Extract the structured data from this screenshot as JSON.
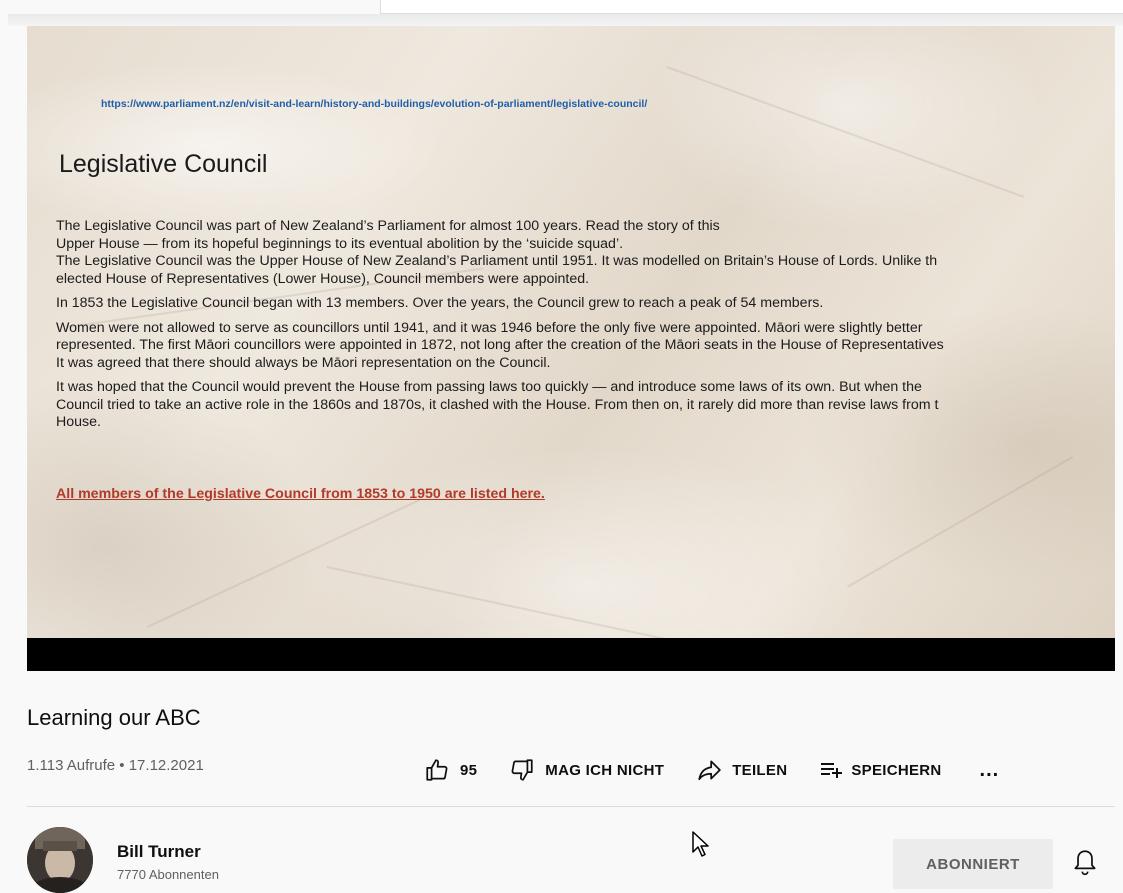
{
  "slide": {
    "url": "https://www.parliament.nz/en/visit-and-learn/history-and-buildings/evolution-of-parliament/legislative-council/",
    "title": "Legislative Council",
    "paragraphs": [
      "The Legislative Council was part of New Zealand’s Parliament for almost 100 years. Read the story of this",
      "Upper House — from its hopeful beginnings to its eventual abolition by the ‘suicide squad’.",
      "The Legislative Council was the Upper House of New Zealand’s Parliament until 1951. It was modelled on Britain’s House of Lords. Unlike th",
      "elected House of Representatives (Lower House), Council members were appointed.",
      "In 1853 the Legislative Council began with 13 members. Over the years, the Council grew to reach a peak of 54 members.",
      "Women were not allowed to serve as councillors until 1941, and it was 1946 before the only five were appointed. Māori were slightly better",
      "represented. The first Māori councillors were appointed in 1872, not long after the creation of the Māori seats in the House of Representatives",
      "It was agreed that there should always be Māori representation on the Council.",
      "It was hoped that the Council would prevent the House from passing laws too quickly — and introduce some laws of its own. But when the",
      "Council tried to take an active role in the 1860s and 1870s, it clashed with the House. From then on, it rarely did more than revise laws from t",
      "House."
    ],
    "link": "All members of the Legislative Council from 1853 to 1950 are listed here."
  },
  "video": {
    "title": "Learning our ABC",
    "meta": "1.113 Aufrufe • 17.12.2021"
  },
  "actions": {
    "like_count": "95",
    "dislike_label": "MAG ICH NICHT",
    "share_label": "TEILEN",
    "save_label": "SPEICHERN",
    "more_label": "..."
  },
  "channel": {
    "name": "Bill Turner",
    "subscribers": "7770 Abonnenten",
    "subscribe_label": "ABONNIERT"
  },
  "colors": {
    "link_blue": "#1f5fa8",
    "link_red": "#b23a2a",
    "text_secondary": "#606060"
  }
}
